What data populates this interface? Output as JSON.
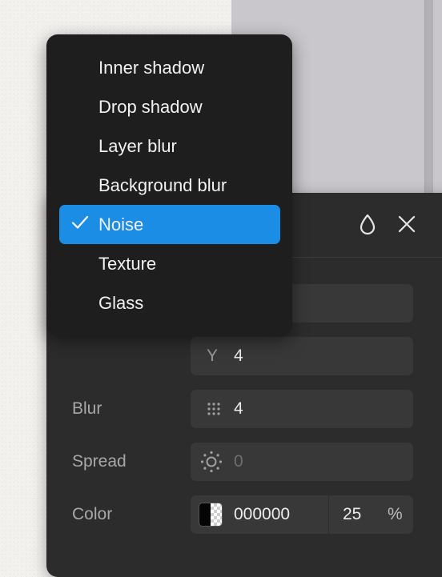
{
  "effect_menu": {
    "items": [
      {
        "label": "Inner shadow",
        "selected": false
      },
      {
        "label": "Drop shadow",
        "selected": false
      },
      {
        "label": "Layer blur",
        "selected": false
      },
      {
        "label": "Background blur",
        "selected": false
      },
      {
        "label": "Noise",
        "selected": true
      },
      {
        "label": "Texture",
        "selected": false
      },
      {
        "label": "Glass",
        "selected": false
      }
    ]
  },
  "effect_panel": {
    "header_icons": [
      "drop-icon",
      "close-icon"
    ],
    "y": {
      "prefix": "Y",
      "value": "4"
    },
    "blur": {
      "label": "Blur",
      "value": "4",
      "icon": "blur-dots-icon"
    },
    "spread": {
      "label": "Spread",
      "value": "0",
      "icon": "spread-sun-icon"
    },
    "color": {
      "label": "Color",
      "hex": "000000",
      "opacity": "25",
      "unit": "%",
      "swatch_color": "#000000"
    }
  },
  "colors": {
    "accent": "#1b8de4",
    "menu_bg": "#1e1e1e",
    "panel_bg": "#2c2c2c",
    "field_bg": "#383838"
  }
}
